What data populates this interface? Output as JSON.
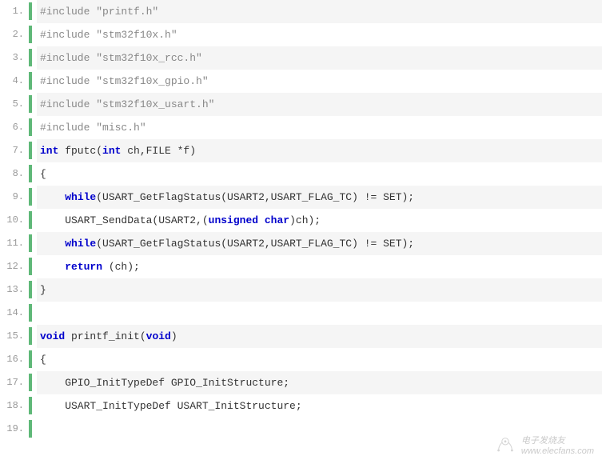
{
  "lines": [
    {
      "num": "1.",
      "tokens": [
        {
          "cls": "pp",
          "t": "#include \"printf.h\""
        }
      ]
    },
    {
      "num": "2.",
      "tokens": [
        {
          "cls": "pp",
          "t": "#include \"stm32f10x.h\""
        }
      ]
    },
    {
      "num": "3.",
      "tokens": [
        {
          "cls": "pp",
          "t": "#include \"stm32f10x_rcc.h\""
        }
      ]
    },
    {
      "num": "4.",
      "tokens": [
        {
          "cls": "pp",
          "t": "#include \"stm32f10x_gpio.h\""
        }
      ]
    },
    {
      "num": "5.",
      "tokens": [
        {
          "cls": "pp",
          "t": "#include \"stm32f10x_usart.h\""
        }
      ]
    },
    {
      "num": "6.",
      "tokens": [
        {
          "cls": "pp",
          "t": "#include \"misc.h\""
        }
      ]
    },
    {
      "num": "7.",
      "tokens": [
        {
          "cls": "kw",
          "t": "int"
        },
        {
          "cls": "txt",
          "t": " fputc("
        },
        {
          "cls": "kw",
          "t": "int"
        },
        {
          "cls": "txt",
          "t": " ch,FILE *f)"
        }
      ]
    },
    {
      "num": "8.",
      "tokens": [
        {
          "cls": "txt",
          "t": "{"
        }
      ]
    },
    {
      "num": "9.",
      "tokens": [
        {
          "cls": "txt",
          "t": "    "
        },
        {
          "cls": "kw",
          "t": "while"
        },
        {
          "cls": "txt",
          "t": "(USART_GetFlagStatus(USART2,USART_FLAG_TC) != SET);"
        }
      ]
    },
    {
      "num": "10.",
      "tokens": [
        {
          "cls": "txt",
          "t": "    USART_SendData(USART2,("
        },
        {
          "cls": "kw",
          "t": "unsigned"
        },
        {
          "cls": "txt",
          "t": " "
        },
        {
          "cls": "kw",
          "t": "char"
        },
        {
          "cls": "txt",
          "t": ")ch);"
        }
      ]
    },
    {
      "num": "11.",
      "tokens": [
        {
          "cls": "txt",
          "t": "    "
        },
        {
          "cls": "kw",
          "t": "while"
        },
        {
          "cls": "txt",
          "t": "(USART_GetFlagStatus(USART2,USART_FLAG_TC) != SET);"
        }
      ]
    },
    {
      "num": "12.",
      "tokens": [
        {
          "cls": "txt",
          "t": "    "
        },
        {
          "cls": "kw",
          "t": "return"
        },
        {
          "cls": "txt",
          "t": " (ch);"
        }
      ]
    },
    {
      "num": "13.",
      "tokens": [
        {
          "cls": "txt",
          "t": "}"
        }
      ]
    },
    {
      "num": "14.",
      "tokens": [
        {
          "cls": "txt",
          "t": ""
        }
      ]
    },
    {
      "num": "15.",
      "tokens": [
        {
          "cls": "kw",
          "t": "void"
        },
        {
          "cls": "txt",
          "t": " printf_init("
        },
        {
          "cls": "kw",
          "t": "void"
        },
        {
          "cls": "txt",
          "t": ")"
        }
      ]
    },
    {
      "num": "16.",
      "tokens": [
        {
          "cls": "txt",
          "t": "{"
        }
      ]
    },
    {
      "num": "17.",
      "tokens": [
        {
          "cls": "txt",
          "t": "    GPIO_InitTypeDef GPIO_InitStructure;"
        }
      ]
    },
    {
      "num": "18.",
      "tokens": [
        {
          "cls": "txt",
          "t": "    USART_InitTypeDef USART_InitStructure;"
        }
      ]
    },
    {
      "num": "19.",
      "tokens": [
        {
          "cls": "txt",
          "t": ""
        }
      ]
    }
  ],
  "watermark": {
    "line1": "电子发烧友",
    "line2": "www.elecfans.com"
  }
}
